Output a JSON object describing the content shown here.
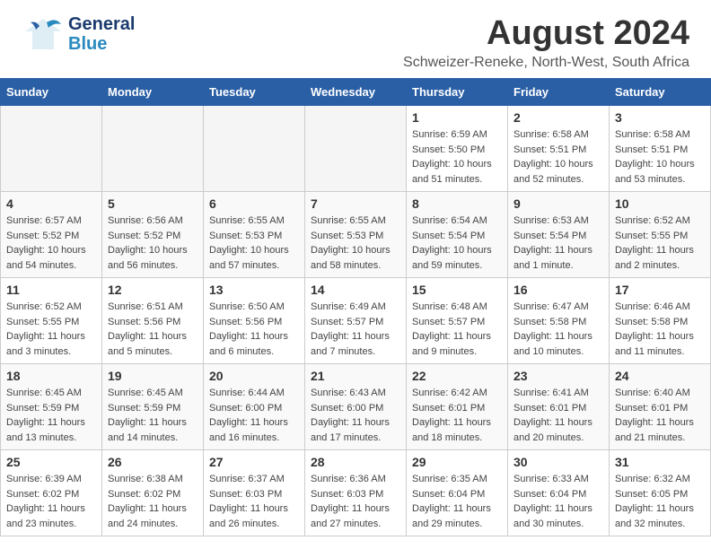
{
  "header": {
    "logo_general": "General",
    "logo_blue": "Blue",
    "main_title": "August 2024",
    "sub_title": "Schweizer-Reneke, North-West, South Africa"
  },
  "calendar": {
    "days_of_week": [
      "Sunday",
      "Monday",
      "Tuesday",
      "Wednesday",
      "Thursday",
      "Friday",
      "Saturday"
    ],
    "weeks": [
      [
        {
          "num": "",
          "empty": true
        },
        {
          "num": "",
          "empty": true
        },
        {
          "num": "",
          "empty": true
        },
        {
          "num": "",
          "empty": true
        },
        {
          "num": "1",
          "sunrise": "6:59 AM",
          "sunset": "5:50 PM",
          "daylight": "10 hours and 51 minutes."
        },
        {
          "num": "2",
          "sunrise": "6:58 AM",
          "sunset": "5:51 PM",
          "daylight": "10 hours and 52 minutes."
        },
        {
          "num": "3",
          "sunrise": "6:58 AM",
          "sunset": "5:51 PM",
          "daylight": "10 hours and 53 minutes."
        }
      ],
      [
        {
          "num": "4",
          "sunrise": "6:57 AM",
          "sunset": "5:52 PM",
          "daylight": "10 hours and 54 minutes."
        },
        {
          "num": "5",
          "sunrise": "6:56 AM",
          "sunset": "5:52 PM",
          "daylight": "10 hours and 56 minutes."
        },
        {
          "num": "6",
          "sunrise": "6:55 AM",
          "sunset": "5:53 PM",
          "daylight": "10 hours and 57 minutes."
        },
        {
          "num": "7",
          "sunrise": "6:55 AM",
          "sunset": "5:53 PM",
          "daylight": "10 hours and 58 minutes."
        },
        {
          "num": "8",
          "sunrise": "6:54 AM",
          "sunset": "5:54 PM",
          "daylight": "10 hours and 59 minutes."
        },
        {
          "num": "9",
          "sunrise": "6:53 AM",
          "sunset": "5:54 PM",
          "daylight": "11 hours and 1 minute."
        },
        {
          "num": "10",
          "sunrise": "6:52 AM",
          "sunset": "5:55 PM",
          "daylight": "11 hours and 2 minutes."
        }
      ],
      [
        {
          "num": "11",
          "sunrise": "6:52 AM",
          "sunset": "5:55 PM",
          "daylight": "11 hours and 3 minutes."
        },
        {
          "num": "12",
          "sunrise": "6:51 AM",
          "sunset": "5:56 PM",
          "daylight": "11 hours and 5 minutes."
        },
        {
          "num": "13",
          "sunrise": "6:50 AM",
          "sunset": "5:56 PM",
          "daylight": "11 hours and 6 minutes."
        },
        {
          "num": "14",
          "sunrise": "6:49 AM",
          "sunset": "5:57 PM",
          "daylight": "11 hours and 7 minutes."
        },
        {
          "num": "15",
          "sunrise": "6:48 AM",
          "sunset": "5:57 PM",
          "daylight": "11 hours and 9 minutes."
        },
        {
          "num": "16",
          "sunrise": "6:47 AM",
          "sunset": "5:58 PM",
          "daylight": "11 hours and 10 minutes."
        },
        {
          "num": "17",
          "sunrise": "6:46 AM",
          "sunset": "5:58 PM",
          "daylight": "11 hours and 11 minutes."
        }
      ],
      [
        {
          "num": "18",
          "sunrise": "6:45 AM",
          "sunset": "5:59 PM",
          "daylight": "11 hours and 13 minutes."
        },
        {
          "num": "19",
          "sunrise": "6:45 AM",
          "sunset": "5:59 PM",
          "daylight": "11 hours and 14 minutes."
        },
        {
          "num": "20",
          "sunrise": "6:44 AM",
          "sunset": "6:00 PM",
          "daylight": "11 hours and 16 minutes."
        },
        {
          "num": "21",
          "sunrise": "6:43 AM",
          "sunset": "6:00 PM",
          "daylight": "11 hours and 17 minutes."
        },
        {
          "num": "22",
          "sunrise": "6:42 AM",
          "sunset": "6:01 PM",
          "daylight": "11 hours and 18 minutes."
        },
        {
          "num": "23",
          "sunrise": "6:41 AM",
          "sunset": "6:01 PM",
          "daylight": "11 hours and 20 minutes."
        },
        {
          "num": "24",
          "sunrise": "6:40 AM",
          "sunset": "6:01 PM",
          "daylight": "11 hours and 21 minutes."
        }
      ],
      [
        {
          "num": "25",
          "sunrise": "6:39 AM",
          "sunset": "6:02 PM",
          "daylight": "11 hours and 23 minutes."
        },
        {
          "num": "26",
          "sunrise": "6:38 AM",
          "sunset": "6:02 PM",
          "daylight": "11 hours and 24 minutes."
        },
        {
          "num": "27",
          "sunrise": "6:37 AM",
          "sunset": "6:03 PM",
          "daylight": "11 hours and 26 minutes."
        },
        {
          "num": "28",
          "sunrise": "6:36 AM",
          "sunset": "6:03 PM",
          "daylight": "11 hours and 27 minutes."
        },
        {
          "num": "29",
          "sunrise": "6:35 AM",
          "sunset": "6:04 PM",
          "daylight": "11 hours and 29 minutes."
        },
        {
          "num": "30",
          "sunrise": "6:33 AM",
          "sunset": "6:04 PM",
          "daylight": "11 hours and 30 minutes."
        },
        {
          "num": "31",
          "sunrise": "6:32 AM",
          "sunset": "6:05 PM",
          "daylight": "11 hours and 32 minutes."
        }
      ]
    ]
  }
}
